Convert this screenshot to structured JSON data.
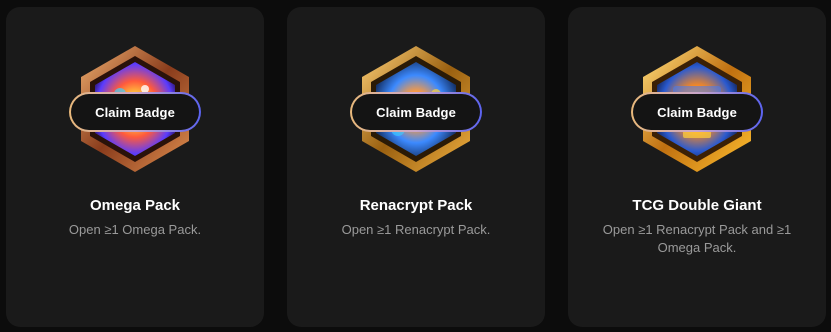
{
  "cards": [
    {
      "title": "Omega Pack",
      "description": "Open ≥1 Omega Pack.",
      "button_label": "Claim Badge",
      "badge_icon": "omega-pack-badge",
      "frame_colors": [
        "#7a3a1c",
        "#d98a4a",
        "#f0b070"
      ],
      "inner_colors": [
        "#5a3cff",
        "#ff5a3c",
        "#ffd23c"
      ]
    },
    {
      "title": "Renacrypt Pack",
      "description": "Open ≥1 Renacrypt Pack.",
      "button_label": "Claim Badge",
      "badge_icon": "renacrypt-pack-badge",
      "frame_colors": [
        "#8a5a10",
        "#e0a030",
        "#ffd27a"
      ],
      "inner_colors": [
        "#1c4a8a",
        "#3c8aff",
        "#ff9a3c"
      ]
    },
    {
      "title": "TCG Double Giant",
      "description": "Open ≥1 Renacrypt Pack and ≥1 Omega Pack.",
      "button_label": "Claim Badge",
      "badge_icon": "tcg-double-giant-badge",
      "frame_colors": [
        "#a86010",
        "#ffb020",
        "#ffe080"
      ],
      "inner_colors": [
        "#2a5ad0",
        "#ff8a1c",
        "#ffd23c"
      ]
    }
  ],
  "button_gradient": [
    "#e8b87a",
    "#5b63f0"
  ]
}
